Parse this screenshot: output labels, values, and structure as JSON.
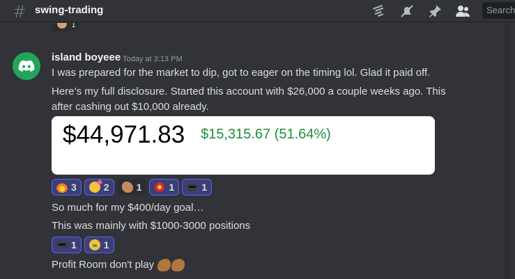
{
  "header": {
    "channel_name": "swing-trading",
    "search_placeholder": "Search"
  },
  "previous_reaction": {
    "count": "1"
  },
  "message": {
    "username": "island boyeee",
    "timestamp": "Today at 3:13 PM",
    "line1": "I was prepared for the market to dip, got to eager on the timing lol. Glad it paid off.",
    "line2a": "Here’s my full disclosure. Started this account with $26,000 a couple weeks ago. This",
    "line2b": "after cashing out $10,000 already.",
    "embed": {
      "value": "$44,971.83",
      "gain": "$15,315.67 (51.64%)"
    },
    "reactions": [
      {
        "emoji": "fire-emoji",
        "count": "3"
      },
      {
        "emoji": "party-face-emoji",
        "count": "2"
      },
      {
        "emoji": "clapping-hands-emoji",
        "count": "1"
      },
      {
        "emoji": "collision-emoji",
        "count": "1"
      },
      {
        "emoji": "sunglasses-emoji",
        "count": "1"
      }
    ],
    "line3": "So much for my $400/day goal…",
    "line4": "This was mainly with $1000-3000 positions",
    "reactions2": [
      {
        "emoji": "sunglasses-emoji",
        "count": "1"
      },
      {
        "emoji": "money-mouth-emoji",
        "count": "1"
      }
    ],
    "line5": "Profit Room don't play"
  },
  "colors": {
    "background": "#313338",
    "embed_background": "#ffffff",
    "gain_green": "#1e8e3e",
    "avatar_green": "#23a559",
    "reaction_active_border": "#5865f2"
  }
}
